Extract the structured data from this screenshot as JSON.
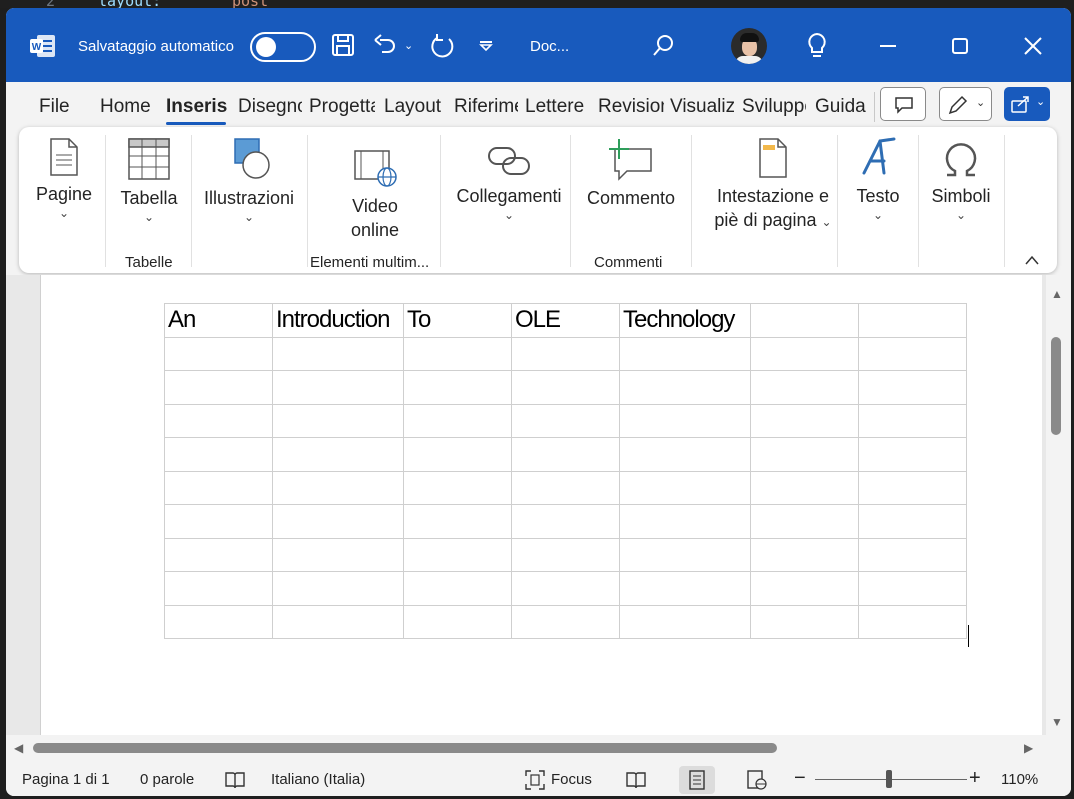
{
  "background_code": {
    "line_number": "2",
    "keyword": "layout:",
    "value": "post"
  },
  "titlebar": {
    "autosave_label": "Salvataggio automatico",
    "doc_title": "Doc...",
    "colors": {
      "accent": "#185abd"
    }
  },
  "menu_tabs": [
    "File",
    "Home",
    "Inserisci",
    "Disegno",
    "Progettazione",
    "Layout",
    "Riferimenti",
    "Lettere",
    "Revisione",
    "Visualizza",
    "Sviluppo",
    "Guida"
  ],
  "ribbon": {
    "pagine": "Pagine",
    "tabella": "Tabella",
    "illustrazioni": "Illustrazioni",
    "video_line1": "Video",
    "video_line2": "online",
    "collegamenti": "Collegamenti",
    "commento": "Commento",
    "intestazione_line1": "Intestazione e",
    "intestazione_line2": "piè di pagina",
    "testo": "Testo",
    "simboli": "Simboli",
    "groups": {
      "tabelle": "Tabelle",
      "elementi": "Elementi multim...",
      "commenti": "Commenti"
    }
  },
  "document": {
    "table_header": [
      "An",
      "Introduction",
      "To",
      "OLE",
      "Technology",
      "",
      ""
    ],
    "empty_rows": 9
  },
  "status": {
    "page": "Pagina 1 di 1",
    "words": "0 parole",
    "language": "Italiano (Italia)",
    "focus": "Focus",
    "zoom": "110%"
  }
}
